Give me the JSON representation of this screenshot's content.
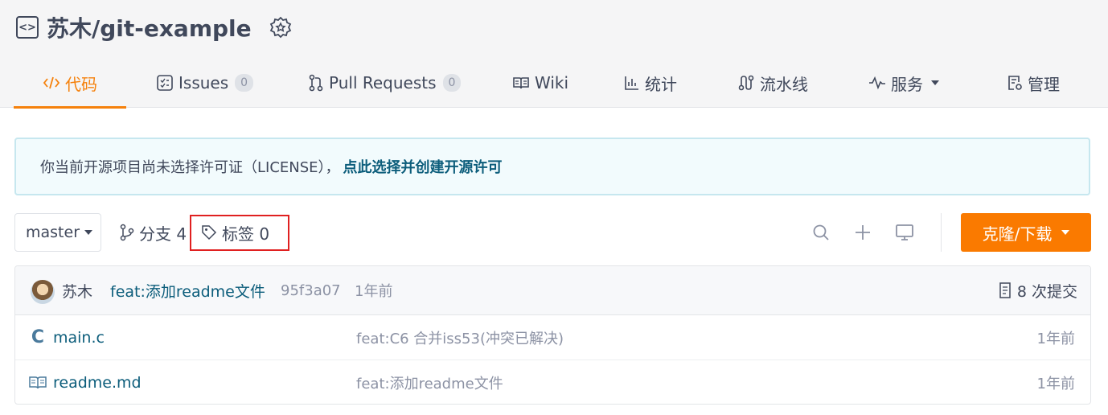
{
  "repo": {
    "full_name": "苏木/git-example"
  },
  "tabs": [
    {
      "label": "代码",
      "icon": "code-icon"
    },
    {
      "label": "Issues",
      "badge": "0",
      "icon": "issues-icon"
    },
    {
      "label": "Pull Requests",
      "badge": "0",
      "icon": "pull-request-icon"
    },
    {
      "label": "Wiki",
      "icon": "wiki-icon"
    },
    {
      "label": "统计",
      "icon": "stats-icon"
    },
    {
      "label": "流水线",
      "icon": "pipeline-icon"
    },
    {
      "label": "服务",
      "icon": "activity-icon"
    },
    {
      "label": "管理",
      "icon": "settings-doc-icon"
    }
  ],
  "notice": {
    "text": "你当前开源项目尚未选择许可证（LICENSE），",
    "link": "点此选择并创建开源许可"
  },
  "toolbar": {
    "branch": "master",
    "branches_label": "分支 4",
    "tags_label": "标签 0",
    "clone_label": "克隆/下载"
  },
  "latest_commit": {
    "author": "苏木",
    "message": "feat:添加readme文件",
    "sha": "95f3a07",
    "time": "1年前",
    "count_label": "8 次提交"
  },
  "files": [
    {
      "name": "main.c",
      "icon": "c-file-icon",
      "commit": "feat:C6 合并iss53(冲突已解决)",
      "time": "1年前"
    },
    {
      "name": "readme.md",
      "icon": "book-icon",
      "commit": "feat:添加readme文件",
      "time": "1年前"
    }
  ],
  "colors": {
    "accent": "#f5810c",
    "clone_button": "#fa7a00",
    "link": "#0c5d7b",
    "highlight_box": "#e02020"
  }
}
